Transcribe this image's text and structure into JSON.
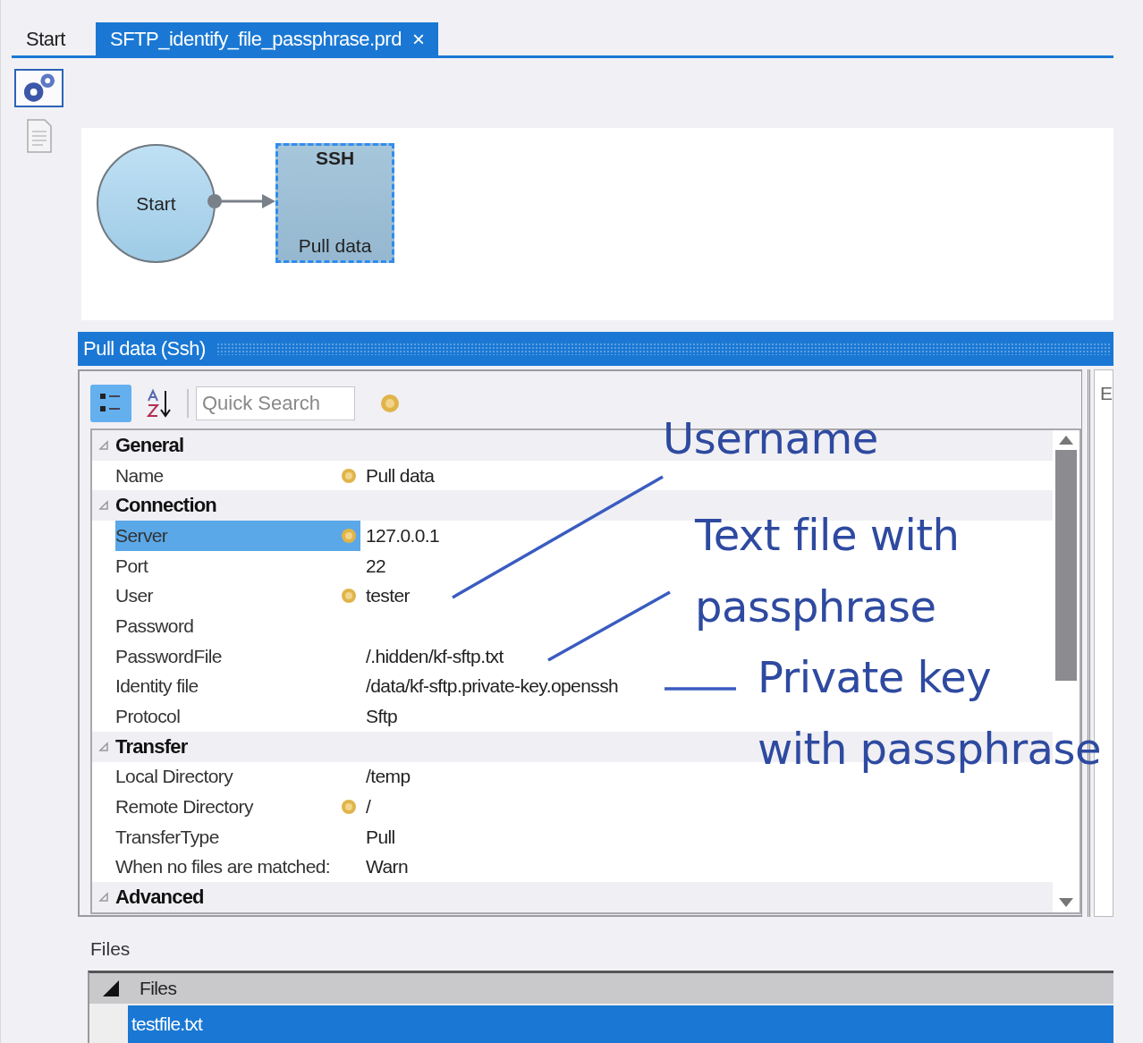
{
  "tabs": [
    {
      "label": "Start",
      "selected": false
    },
    {
      "label": "SFTP_identify_file_passphrase.prd",
      "selected": true,
      "close": "×"
    }
  ],
  "side_tools": [
    {
      "kind": "gear",
      "selected": true
    },
    {
      "kind": "document",
      "selected": false
    }
  ],
  "diagram": {
    "nodes": [
      {
        "kind": "start",
        "label": "Start"
      },
      {
        "kind": "activity",
        "title": "SSH",
        "label": "Pull data",
        "selected": true
      }
    ]
  },
  "panel": {
    "title": "Pull data (Ssh)",
    "toolbar": {
      "categorized_selected": true,
      "sort_selected": false,
      "search_placeholder": "Quick Search"
    },
    "properties": [
      {
        "kind": "category",
        "label": "General",
        "expanded": true
      },
      {
        "kind": "property",
        "label": "Name",
        "flagged": true,
        "value": "Pull data",
        "selected": false
      },
      {
        "kind": "category",
        "label": "Connection",
        "expanded": true
      },
      {
        "kind": "property",
        "label": "Server",
        "flagged": true,
        "value": "127.0.0.1",
        "selected": true
      },
      {
        "kind": "property",
        "label": "Port",
        "flagged": false,
        "value": "22",
        "selected": false
      },
      {
        "kind": "property",
        "label": "User",
        "flagged": true,
        "value": "tester",
        "selected": false
      },
      {
        "kind": "property",
        "label": "Password",
        "flagged": false,
        "selected": false
      },
      {
        "kind": "property",
        "label": "PasswordFile",
        "flagged": false,
        "value": "/.hidden/kf-sftp.txt",
        "selected": false
      },
      {
        "kind": "property",
        "label": "Identity file",
        "flagged": false,
        "value": "/data/kf-sftp.private-key.openssh",
        "selected": false
      },
      {
        "kind": "property",
        "label": "Protocol",
        "flagged": false,
        "value": "Sftp",
        "selected": false
      },
      {
        "kind": "category",
        "label": "Transfer",
        "expanded": true
      },
      {
        "kind": "property",
        "label": "Local Directory",
        "flagged": false,
        "value": "/temp",
        "selected": false
      },
      {
        "kind": "property",
        "label": "Remote Directory",
        "flagged": true,
        "value": "/",
        "selected": false
      },
      {
        "kind": "property",
        "label": "TransferType",
        "flagged": false,
        "value": "Pull",
        "selected": false
      },
      {
        "kind": "property",
        "label": "When no files are matched:",
        "flagged": false,
        "value": "Warn",
        "selected": false
      },
      {
        "kind": "category",
        "label": "Advanced",
        "expanded": true
      }
    ],
    "side_panel_text": "E"
  },
  "files": {
    "label": "Files",
    "columns": [
      "Files"
    ],
    "rows": [
      {
        "name": "testfile.txt",
        "selected": true
      }
    ]
  },
  "annotations": [
    {
      "lines": [
        "Username"
      ]
    },
    {
      "lines": [
        "Text file with",
        "passphrase"
      ]
    },
    {
      "lines": [
        "Private key",
        "with passphrase"
      ]
    }
  ]
}
